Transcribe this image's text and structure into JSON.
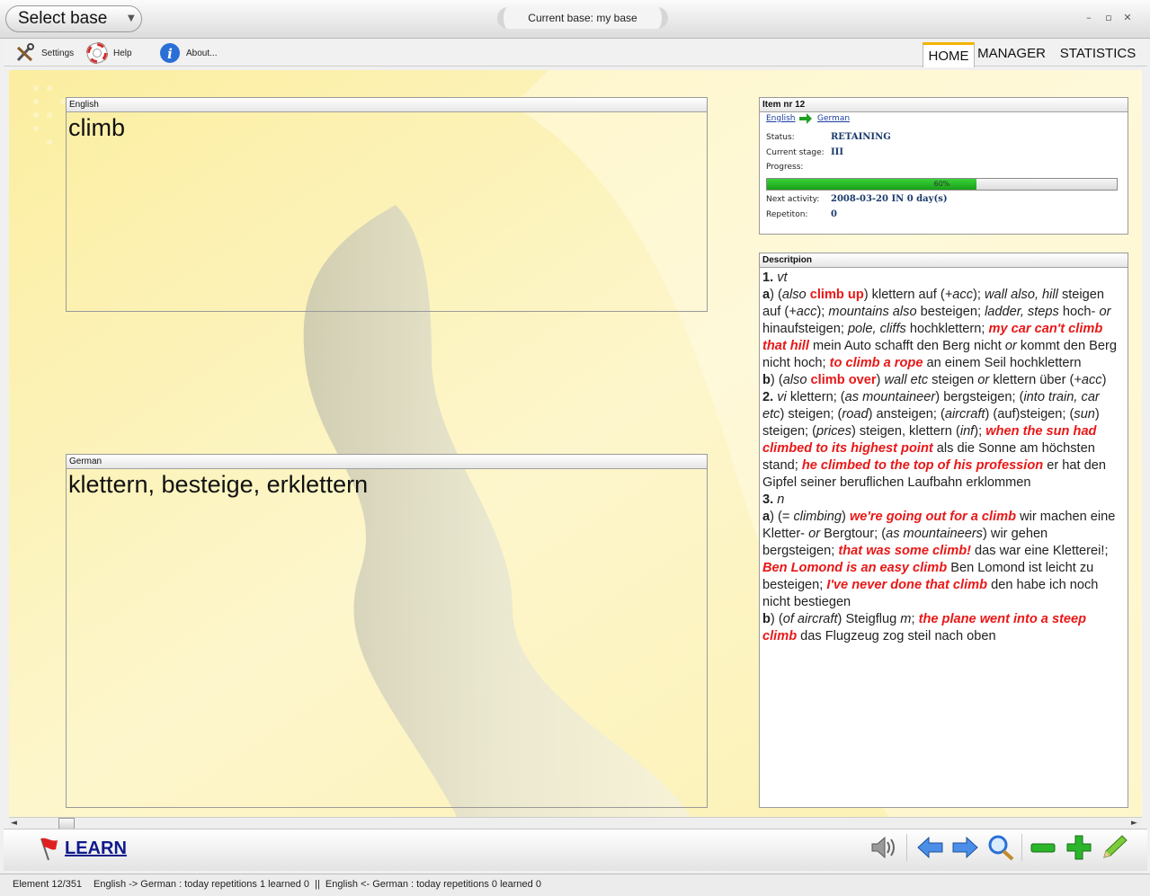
{
  "titlebar": {
    "select_base": "Select base",
    "current_base": "Current base:  my base",
    "window_buttons": [
      "–",
      "▫",
      "✕"
    ]
  },
  "toolbar": {
    "settings": "Settings",
    "help": "Help",
    "about": "About..."
  },
  "tabs": [
    "HOME",
    "MANAGER",
    "STATISTICS"
  ],
  "question": {
    "label": "English",
    "text": "climb"
  },
  "answer": {
    "label": "German",
    "text": "klettern, besteige, erklettern"
  },
  "item": {
    "title": "Item nr 12",
    "from_lang": "English",
    "to_lang": "German",
    "status_label": "Status:",
    "status": "RETAINING",
    "stage_label": "Current stage:",
    "stage": "III",
    "progress_label": "Progress:",
    "progress": 0.6,
    "progress_text": "60%",
    "next_label": "Next activity:",
    "next": "2008-03-20 IN 0 day(s)",
    "rep_label": "Repetiton:",
    "repetitions": "0"
  },
  "description": {
    "title": "Descritpion",
    "lines": [
      [
        [
          "b",
          "1."
        ],
        [
          "t",
          " "
        ],
        [
          "i",
          "vt"
        ]
      ],
      [
        [
          "b",
          "a"
        ],
        [
          "t",
          ") ("
        ],
        [
          "i",
          "also "
        ],
        [
          "rb",
          "climb up"
        ],
        [
          "t",
          ") klettern auf ("
        ],
        [
          "i",
          "+acc"
        ],
        [
          "t",
          "); "
        ],
        [
          "i",
          "wall also, hill"
        ],
        [
          "t",
          " steigen auf ("
        ],
        [
          "i",
          "+acc"
        ],
        [
          "t",
          "); "
        ],
        [
          "i",
          "mountains also"
        ],
        [
          "t",
          " besteigen; "
        ],
        [
          "i",
          "ladder, steps"
        ],
        [
          "t",
          " hoch- "
        ],
        [
          "i",
          "or"
        ],
        [
          "t",
          " hinaufsteigen; "
        ],
        [
          "i",
          "pole, cliffs"
        ],
        [
          "t",
          " hochklettern; "
        ],
        [
          "r",
          "my car can't climb that hill"
        ],
        [
          "t",
          " mein Auto schafft den Berg nicht "
        ],
        [
          "i",
          "or"
        ],
        [
          "t",
          " kommt den Berg nicht hoch; "
        ],
        [
          "r",
          "to climb a rope"
        ],
        [
          "t",
          " an einem Seil hochklettern"
        ]
      ],
      [
        [
          "b",
          "b"
        ],
        [
          "t",
          ") ("
        ],
        [
          "i",
          "also "
        ],
        [
          "rb",
          "climb over"
        ],
        [
          "t",
          ") "
        ],
        [
          "i",
          "wall etc"
        ],
        [
          "t",
          " steigen "
        ],
        [
          "i",
          "or"
        ],
        [
          "t",
          " klettern über ("
        ],
        [
          "i",
          "+acc"
        ],
        [
          "t",
          ")"
        ]
      ],
      [
        [
          "b",
          "2."
        ],
        [
          "t",
          " "
        ],
        [
          "i",
          "vi"
        ],
        [
          "t",
          " klettern; ("
        ],
        [
          "i",
          "as mountaineer"
        ],
        [
          "t",
          ") bergsteigen; ("
        ],
        [
          "i",
          "into train, car etc"
        ],
        [
          "t",
          ") steigen; ("
        ],
        [
          "i",
          "road"
        ],
        [
          "t",
          ") ansteigen; ("
        ],
        [
          "i",
          "aircraft"
        ],
        [
          "t",
          ") (auf)steigen; ("
        ],
        [
          "i",
          "sun"
        ],
        [
          "t",
          ") steigen; ("
        ],
        [
          "i",
          "prices"
        ],
        [
          "t",
          ") steigen, klettern ("
        ],
        [
          "i",
          "inf"
        ],
        [
          "t",
          "); "
        ],
        [
          "r",
          "when the sun had climbed to its highest point"
        ],
        [
          "t",
          " als die Sonne am höchsten stand; "
        ],
        [
          "r",
          "he climbed to the top of his profession"
        ],
        [
          "t",
          " er hat den Gipfel seiner beruflichen Laufbahn erklommen"
        ]
      ],
      [
        [
          "b",
          "3."
        ],
        [
          "t",
          " "
        ],
        [
          "i",
          "n"
        ]
      ],
      [
        [
          "b",
          "a"
        ],
        [
          "t",
          ") (= "
        ],
        [
          "i",
          "climbing"
        ],
        [
          "t",
          ") "
        ],
        [
          "r",
          "we're going out for a climb"
        ],
        [
          "t",
          " wir machen eine Kletter- "
        ],
        [
          "i",
          "or"
        ],
        [
          "t",
          " Bergtour; ("
        ],
        [
          "i",
          "as mountaineers"
        ],
        [
          "t",
          ") wir gehen bergsteigen; "
        ],
        [
          "r",
          "that was some climb!"
        ],
        [
          "t",
          " das war eine Kletterei!; "
        ],
        [
          "r",
          "Ben Lomond is an easy climb"
        ],
        [
          "t",
          " Ben Lomond ist leicht zu besteigen; "
        ],
        [
          "r",
          "I've never done that climb"
        ],
        [
          "t",
          " den habe ich noch nicht bestiegen"
        ]
      ],
      [
        [
          "b",
          "b"
        ],
        [
          "t",
          ") ("
        ],
        [
          "i",
          "of aircraft"
        ],
        [
          "t",
          ") Steigflug "
        ],
        [
          "i",
          "m"
        ],
        [
          "t",
          "; "
        ],
        [
          "r",
          "the plane went into a steep climb"
        ],
        [
          "t",
          " das Flugzeug zog steil nach oben"
        ]
      ]
    ]
  },
  "bottom": {
    "learn": "LEARN"
  },
  "status": {
    "element": "Element 12/351",
    "summary": "English -> German : today repetitions 1 learned 0  ||  English <- German : today repetitions 0 learned 0"
  },
  "colors": {
    "accent": "#f4b400",
    "link": "#0e1a8c",
    "highlight": "#e81818",
    "progress": "#22b022"
  }
}
